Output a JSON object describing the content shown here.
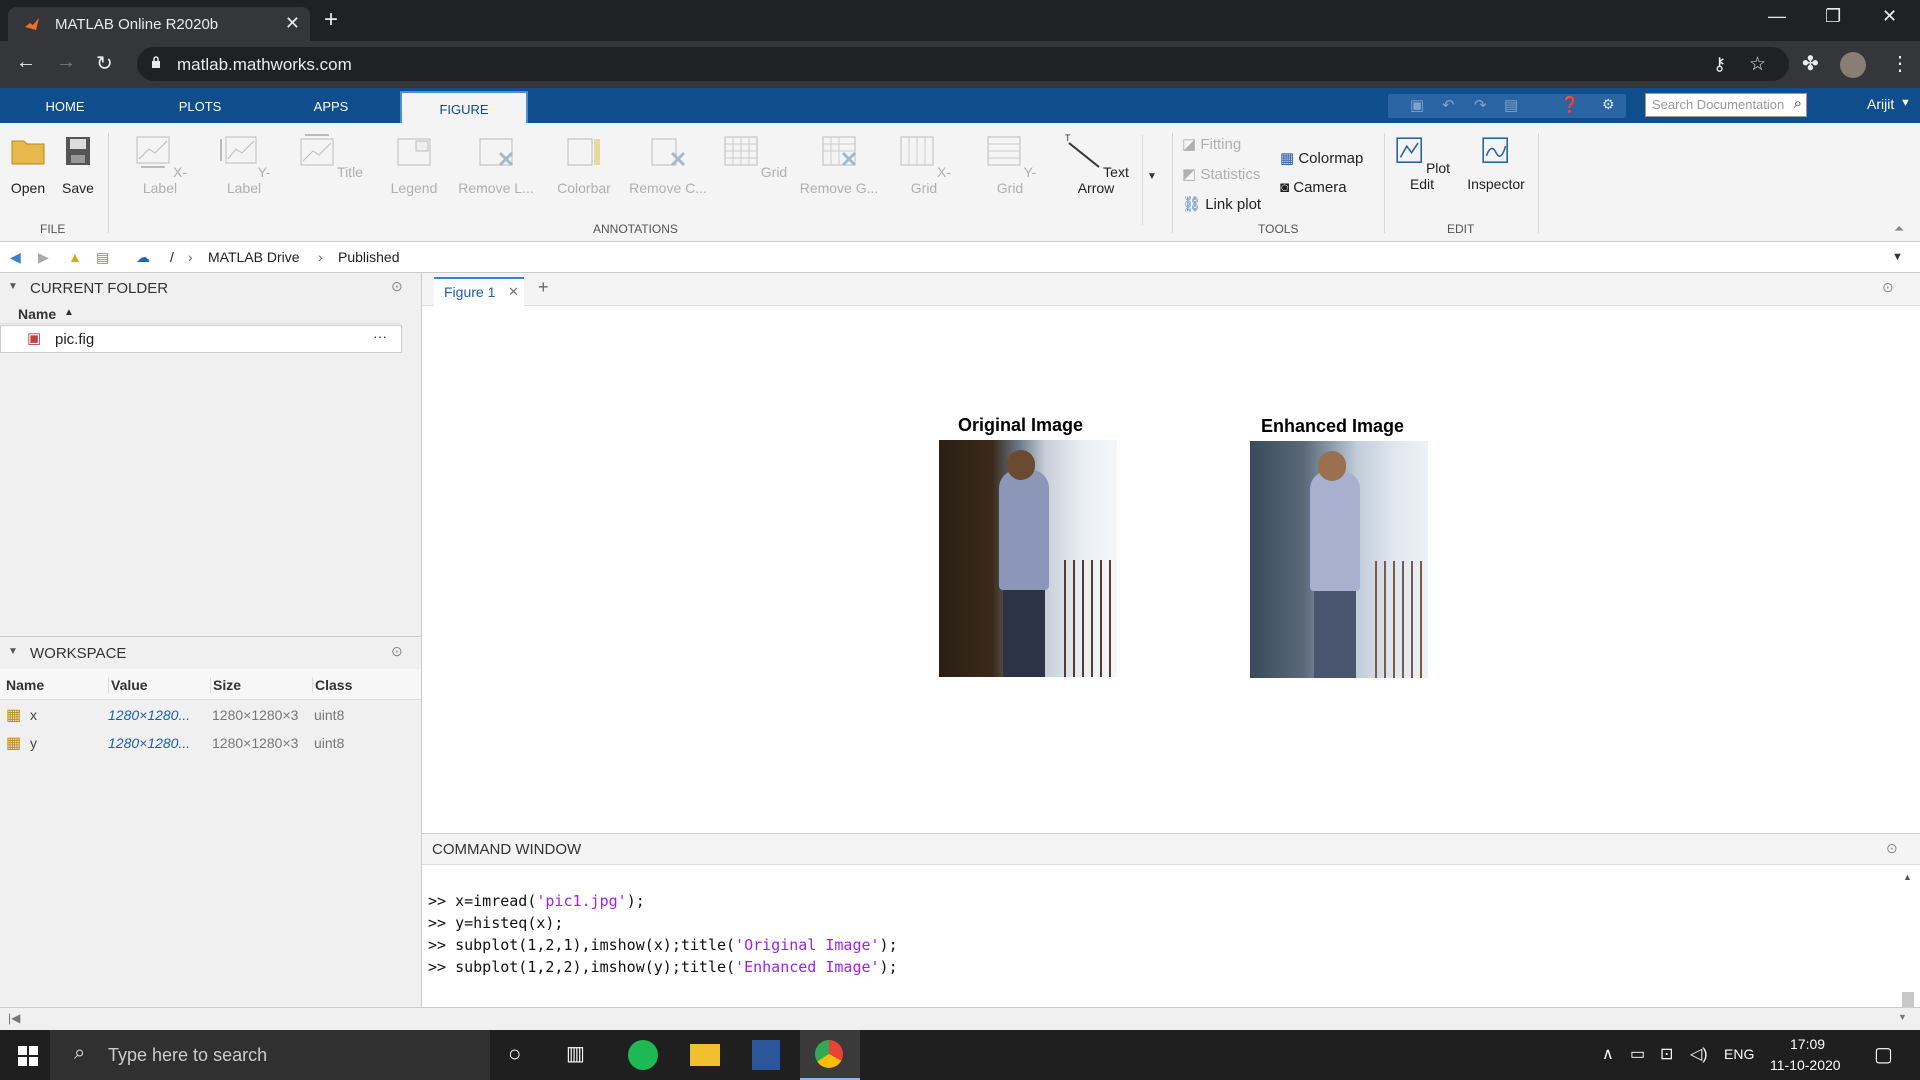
{
  "browser": {
    "tab_title": "MATLAB Online R2020b",
    "url": "matlab.mathworks.com",
    "new_tab": "+",
    "close": "✕",
    "window_controls": [
      "—",
      "❐",
      "✕"
    ]
  },
  "toolstrip": {
    "tabs": [
      "HOME",
      "PLOTS",
      "APPS",
      "FIGURE"
    ],
    "search_placeholder": "Search Documentation",
    "user": "Arijit"
  },
  "ribbon": {
    "file": {
      "open": "Open",
      "save": "Save",
      "group": "FILE"
    },
    "annotations": {
      "items": [
        "X-Label",
        "Y-Label",
        "Title",
        "Legend",
        "Remove L...",
        "Colorbar",
        "Remove C...",
        "Grid",
        "Remove G...",
        "X-Grid",
        "Y-Grid",
        "Text Arrow"
      ],
      "group": "ANNOTATIONS"
    },
    "tools": {
      "fitting": "Fitting",
      "statistics": "Statistics",
      "linkplot": "Link plot",
      "colormap": "Colormap",
      "camera": "Camera",
      "group": "TOOLS"
    },
    "edit": {
      "plotedit": "Plot Edit",
      "inspector": "Inspector",
      "group": "EDIT"
    }
  },
  "folder_bar": {
    "root": "/",
    "crumbs": [
      "MATLAB Drive",
      "Published"
    ]
  },
  "current_folder": {
    "title": "CURRENT FOLDER",
    "col_name": "Name",
    "files": [
      "pic.fig"
    ],
    "more": "···"
  },
  "workspace": {
    "title": "WORKSPACE",
    "columns": [
      "Name",
      "Value",
      "Size",
      "Class"
    ],
    "rows": [
      {
        "name": "x",
        "value": "1280×1280...",
        "size": "1280×1280×3",
        "class": "uint8"
      },
      {
        "name": "y",
        "value": "1280×1280...",
        "size": "1280×1280×3",
        "class": "uint8"
      }
    ]
  },
  "figure": {
    "tab": "Figure 1",
    "add": "+",
    "left_title": "Original Image",
    "right_title": "Enhanced Image"
  },
  "command_window": {
    "title": "COMMAND WINDOW",
    "lines": [
      {
        "pre": ">> x=imread(",
        "str": "'pic1.jpg'",
        "post": ");"
      },
      {
        "pre": ">> y=histeq(x);",
        "str": "",
        "post": ""
      },
      {
        "pre": ">> subplot(1,2,1),imshow(x);title(",
        "str": "'Original Image'",
        "post": ");"
      },
      {
        "pre": ">> subplot(1,2,2),imshow(y);title(",
        "str": "'Enhanced Image'",
        "post": ");"
      }
    ]
  },
  "taskbar": {
    "search_placeholder": "Type here to search",
    "lang": "ENG",
    "time": "17:09",
    "date": "11-10-2020"
  }
}
